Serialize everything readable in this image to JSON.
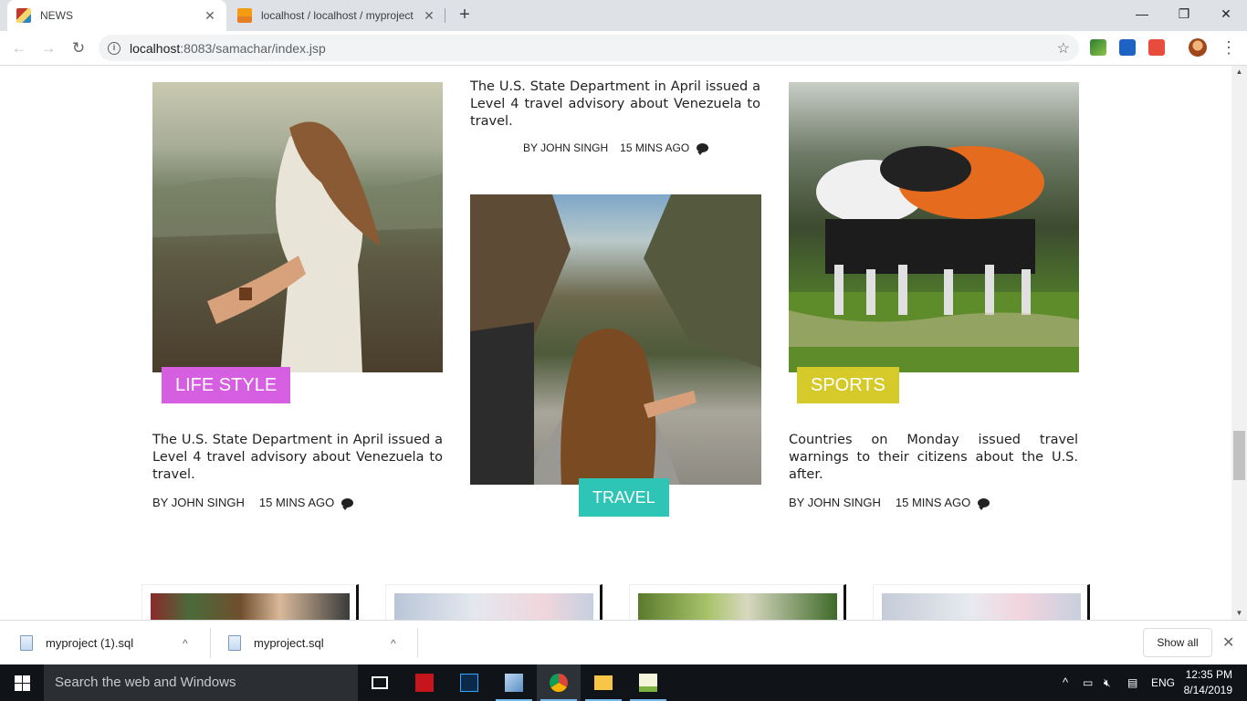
{
  "browser": {
    "tabs": [
      {
        "title": "NEWS",
        "active": true
      },
      {
        "title": "localhost / localhost / myproject",
        "active": false
      }
    ],
    "url_host": "localhost",
    "url_rest": ":8083/samachar/index.jsp",
    "new_tab_glyph": "+",
    "close_glyph": "✕",
    "window_controls": {
      "minimize": "—",
      "restore": "❐",
      "close": "✕"
    },
    "nav": {
      "back": "←",
      "forward": "→",
      "reload": "↻"
    },
    "star_glyph": "☆",
    "menu_glyph": "⋮"
  },
  "articles": {
    "left": {
      "category": "LIFE STYLE",
      "category_color": "#d65ee0",
      "excerpt": "The U.S. State Department in April issued a Level 4 travel advisory about Venezuela to travel.",
      "author": "BY JOHN SINGH",
      "time": "15 MINS AGO",
      "icon": "comment-icon"
    },
    "middle_top": {
      "excerpt": "The U.S. State Department in April issued a Level 4 travel advisory about Venezuela to travel.",
      "author": "BY JOHN SINGH",
      "time": "15 MINS AGO",
      "icon": "comment-icon"
    },
    "middle": {
      "category": "TRAVEL",
      "category_color": "#2ec4b6"
    },
    "right": {
      "category": "SPORTS",
      "category_color": "#d6c92a",
      "excerpt": "Countries on Monday issued travel warnings to their citizens about the U.S. after.",
      "author": "BY JOHN SINGH",
      "time": "15 MINS AGO",
      "icon": "comment-icon"
    }
  },
  "downloads": {
    "items": [
      {
        "name": "myproject (1).sql"
      },
      {
        "name": "myproject.sql"
      }
    ],
    "show_all": "Show all",
    "chevron": "^",
    "close_glyph": "✕"
  },
  "taskbar": {
    "search_placeholder": "Search the web and Windows",
    "language": "ENG",
    "time": "12:35 PM",
    "date": "8/14/2019",
    "tray_up": "^"
  }
}
